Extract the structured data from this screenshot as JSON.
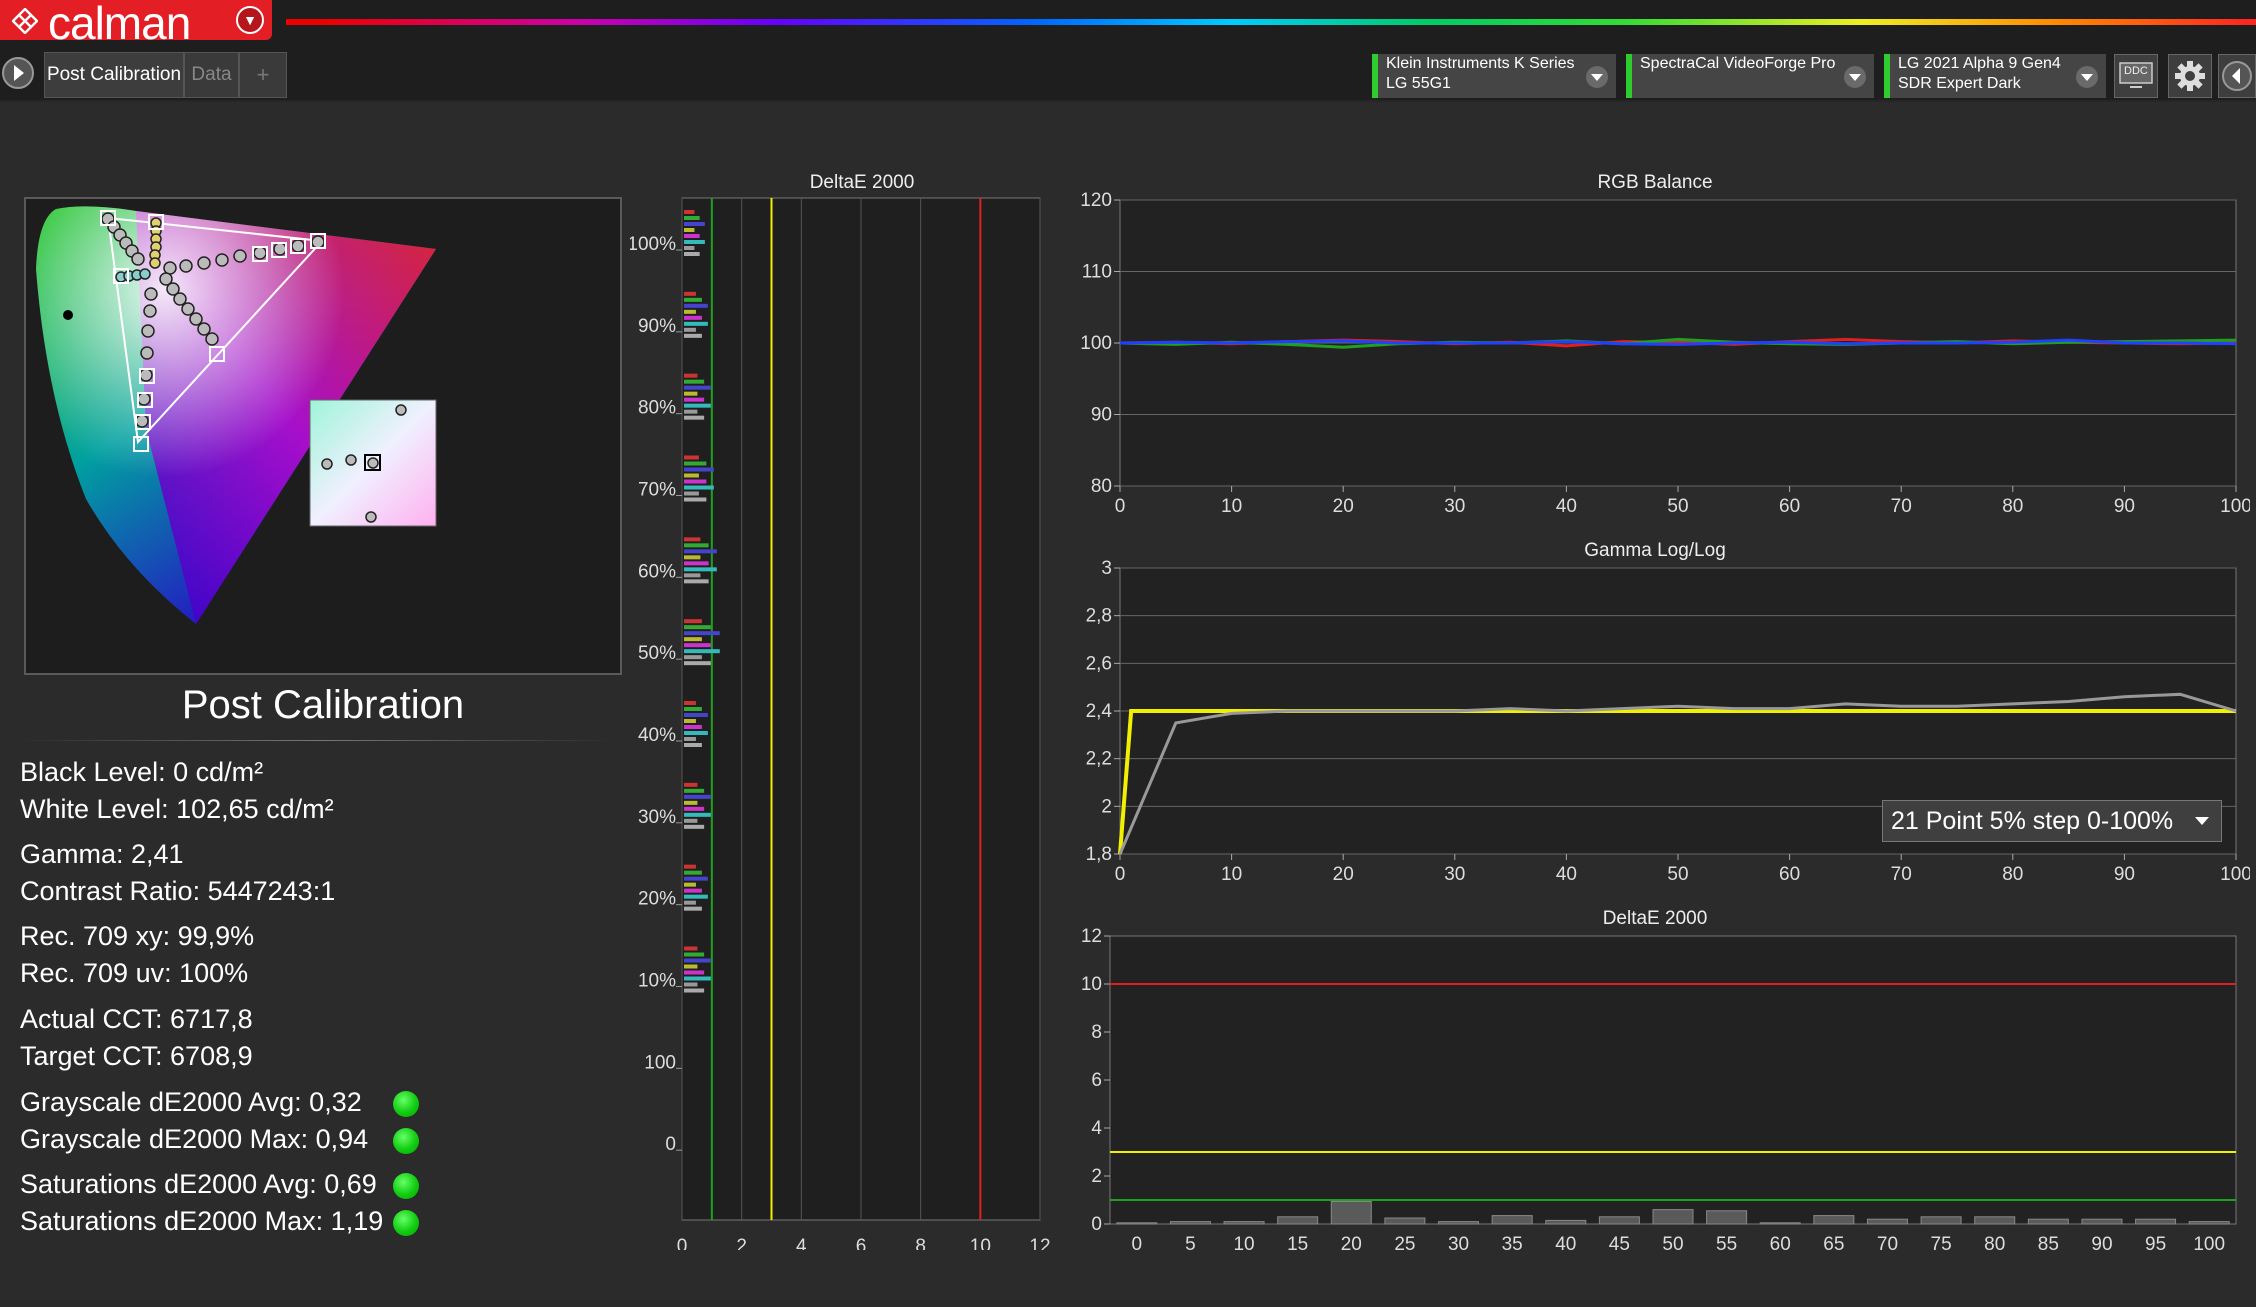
{
  "app": {
    "logo_text": "calman"
  },
  "tabs": [
    {
      "label": "Post Calibration"
    },
    {
      "label": "Data"
    },
    {
      "label": "+"
    }
  ],
  "devices": [
    {
      "line1": "Klein Instruments K Series",
      "line2": "LG 55G1"
    },
    {
      "line1": "SpectraCal VideoForge Pro",
      "line2": ""
    },
    {
      "line1": "LG 2021 Alpha 9 Gen4",
      "line2": "SDR Expert Dark"
    }
  ],
  "ddc_label": "DDC",
  "icons": {
    "play": "play-icon",
    "settings": "gear-icon",
    "collapse": "chevron-left-icon"
  },
  "summary": {
    "title": "Post Calibration",
    "stats": [
      {
        "text": "Black Level: 0 cd/m²"
      },
      {
        "text": "White Level: 102,65 cd/m²"
      },
      {
        "text": "Gamma: 2,41"
      },
      {
        "text": "Contrast Ratio: 5447243:1"
      },
      {
        "text": "Rec. 709 xy: 99,9%"
      },
      {
        "text": "Rec. 709 uv: 100%"
      },
      {
        "text": "Actual CCT: 6717,8"
      },
      {
        "text": "Target CCT: 6708,9"
      },
      {
        "text": "Grayscale dE2000 Avg: 0,32",
        "status": "pass"
      },
      {
        "text": "Grayscale dE2000 Max: 0,94",
        "status": "pass"
      },
      {
        "text": "Saturations dE2000 Avg: 0,69",
        "status": "pass"
      },
      {
        "text": "Saturations dE2000 Max: 1,19",
        "status": "pass"
      }
    ],
    "status_color": "#22cc22"
  },
  "colors": {
    "red": "#e02020",
    "green": "#20a020",
    "blue": "#2040ff",
    "yellow": "#f0f000",
    "gray": "#999999",
    "panel_bg": "#1d1d1d"
  },
  "gamma_dropdown": {
    "selected": "21 Point 5% step 0-100%"
  },
  "chart_data": [
    {
      "type": "bar",
      "title": "DeltaE 2000",
      "orientation": "horizontal",
      "categories": [
        "100%",
        "90%",
        "80%",
        "70%",
        "60%",
        "50%",
        "40%",
        "30%",
        "20%",
        "10%",
        "100",
        "0"
      ],
      "xlim": [
        0,
        12
      ],
      "xticks": [
        0,
        2,
        4,
        6,
        8,
        10,
        12
      ],
      "reference_lines": [
        {
          "x": 1,
          "color": "green"
        },
        {
          "x": 3,
          "color": "yellow"
        },
        {
          "x": 10,
          "color": "red"
        }
      ],
      "values": [
        0.7,
        0.8,
        0.9,
        1.0,
        1.1,
        1.2,
        0.8,
        0.9,
        0.8,
        0.9,
        0,
        0
      ]
    },
    {
      "type": "line",
      "title": "RGB Balance",
      "xlim": [
        0,
        100
      ],
      "ylim": [
        80,
        120
      ],
      "xticks": [
        0,
        10,
        20,
        30,
        40,
        50,
        60,
        70,
        80,
        90,
        100
      ],
      "yticks": [
        80,
        90,
        100,
        110,
        120
      ],
      "x": [
        0,
        5,
        10,
        15,
        20,
        25,
        30,
        35,
        40,
        45,
        50,
        55,
        60,
        65,
        70,
        75,
        80,
        85,
        90,
        95,
        100
      ],
      "series": [
        {
          "color": "red",
          "values": [
            100,
            100.1,
            99.9,
            100.2,
            100.4,
            100.2,
            99.9,
            100.1,
            99.6,
            100.2,
            100.1,
            99.8,
            100.2,
            100.5,
            100.2,
            100.0,
            100.3,
            100.1,
            100.0,
            99.9,
            100.0
          ]
        },
        {
          "color": "green",
          "values": [
            100,
            99.8,
            100.1,
            99.8,
            99.4,
            99.9,
            100.1,
            100.0,
            100.3,
            99.9,
            100.5,
            100.1,
            99.9,
            99.8,
            100.0,
            100.2,
            99.9,
            100.1,
            100.2,
            100.3,
            100.4
          ]
        },
        {
          "color": "blue",
          "values": [
            100,
            100.1,
            100.0,
            100.2,
            100.3,
            100.0,
            100.0,
            100.0,
            100.2,
            99.9,
            99.8,
            100.0,
            100.1,
            99.9,
            100.0,
            100.0,
            100.1,
            100.4,
            100.0,
            100.0,
            99.9
          ]
        }
      ]
    },
    {
      "type": "line",
      "title": "Gamma Log/Log",
      "xlim": [
        0,
        100
      ],
      "ylim": [
        1.8,
        3
      ],
      "xticks": [
        0,
        10,
        20,
        30,
        40,
        50,
        60,
        70,
        80,
        90,
        100
      ],
      "yticks": [
        "1,8",
        "2",
        "2,2",
        "2,4",
        "2,6",
        "2,8",
        "3"
      ],
      "series": [
        {
          "color": "yellow",
          "x": [
            0,
            1,
            5,
            10,
            15,
            20,
            25,
            30,
            35,
            40,
            45,
            50,
            55,
            60,
            65,
            70,
            75,
            80,
            85,
            90,
            95,
            100
          ],
          "values": [
            1.8,
            2.4,
            2.4,
            2.4,
            2.4,
            2.4,
            2.4,
            2.4,
            2.4,
            2.4,
            2.4,
            2.4,
            2.4,
            2.4,
            2.4,
            2.4,
            2.4,
            2.4,
            2.4,
            2.4,
            2.4,
            2.4
          ]
        },
        {
          "color": "gray",
          "x": [
            0,
            5,
            10,
            15,
            20,
            25,
            30,
            35,
            40,
            45,
            50,
            55,
            60,
            65,
            70,
            75,
            80,
            85,
            90,
            95,
            100
          ],
          "values": [
            1.8,
            2.35,
            2.39,
            2.4,
            2.4,
            2.4,
            2.4,
            2.41,
            2.4,
            2.41,
            2.42,
            2.41,
            2.41,
            2.43,
            2.42,
            2.42,
            2.43,
            2.44,
            2.46,
            2.47,
            2.4
          ]
        }
      ]
    },
    {
      "type": "bar",
      "title": "DeltaE 2000",
      "categories": [
        "0",
        "5",
        "10",
        "15",
        "20",
        "25",
        "30",
        "35",
        "40",
        "45",
        "50",
        "55",
        "60",
        "65",
        "70",
        "75",
        "80",
        "85",
        "90",
        "95",
        "100"
      ],
      "values": [
        0.05,
        0.1,
        0.1,
        0.3,
        0.94,
        0.25,
        0.1,
        0.35,
        0.15,
        0.3,
        0.6,
        0.55,
        0.05,
        0.35,
        0.2,
        0.3,
        0.3,
        0.2,
        0.2,
        0.2,
        0.1
      ],
      "ylim": [
        0,
        12
      ],
      "yticks": [
        0,
        2,
        4,
        6,
        8,
        10,
        12
      ],
      "reference_lines": [
        {
          "y": 1,
          "color": "green"
        },
        {
          "y": 3,
          "color": "yellow"
        },
        {
          "y": 10,
          "color": "red"
        }
      ]
    }
  ]
}
